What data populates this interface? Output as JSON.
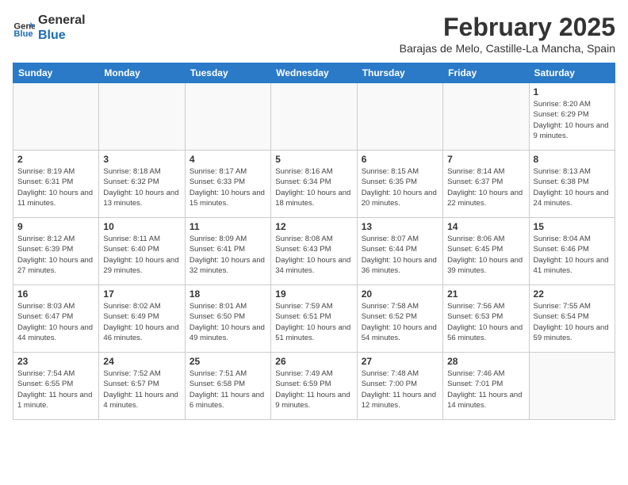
{
  "logo": {
    "line1": "General",
    "line2": "Blue"
  },
  "title": "February 2025",
  "location": "Barajas de Melo, Castille-La Mancha, Spain",
  "days_of_week": [
    "Sunday",
    "Monday",
    "Tuesday",
    "Wednesday",
    "Thursday",
    "Friday",
    "Saturday"
  ],
  "weeks": [
    [
      {
        "day": "",
        "info": ""
      },
      {
        "day": "",
        "info": ""
      },
      {
        "day": "",
        "info": ""
      },
      {
        "day": "",
        "info": ""
      },
      {
        "day": "",
        "info": ""
      },
      {
        "day": "",
        "info": ""
      },
      {
        "day": "1",
        "info": "Sunrise: 8:20 AM\nSunset: 6:29 PM\nDaylight: 10 hours and 9 minutes."
      }
    ],
    [
      {
        "day": "2",
        "info": "Sunrise: 8:19 AM\nSunset: 6:31 PM\nDaylight: 10 hours and 11 minutes."
      },
      {
        "day": "3",
        "info": "Sunrise: 8:18 AM\nSunset: 6:32 PM\nDaylight: 10 hours and 13 minutes."
      },
      {
        "day": "4",
        "info": "Sunrise: 8:17 AM\nSunset: 6:33 PM\nDaylight: 10 hours and 15 minutes."
      },
      {
        "day": "5",
        "info": "Sunrise: 8:16 AM\nSunset: 6:34 PM\nDaylight: 10 hours and 18 minutes."
      },
      {
        "day": "6",
        "info": "Sunrise: 8:15 AM\nSunset: 6:35 PM\nDaylight: 10 hours and 20 minutes."
      },
      {
        "day": "7",
        "info": "Sunrise: 8:14 AM\nSunset: 6:37 PM\nDaylight: 10 hours and 22 minutes."
      },
      {
        "day": "8",
        "info": "Sunrise: 8:13 AM\nSunset: 6:38 PM\nDaylight: 10 hours and 24 minutes."
      }
    ],
    [
      {
        "day": "9",
        "info": "Sunrise: 8:12 AM\nSunset: 6:39 PM\nDaylight: 10 hours and 27 minutes."
      },
      {
        "day": "10",
        "info": "Sunrise: 8:11 AM\nSunset: 6:40 PM\nDaylight: 10 hours and 29 minutes."
      },
      {
        "day": "11",
        "info": "Sunrise: 8:09 AM\nSunset: 6:41 PM\nDaylight: 10 hours and 32 minutes."
      },
      {
        "day": "12",
        "info": "Sunrise: 8:08 AM\nSunset: 6:43 PM\nDaylight: 10 hours and 34 minutes."
      },
      {
        "day": "13",
        "info": "Sunrise: 8:07 AM\nSunset: 6:44 PM\nDaylight: 10 hours and 36 minutes."
      },
      {
        "day": "14",
        "info": "Sunrise: 8:06 AM\nSunset: 6:45 PM\nDaylight: 10 hours and 39 minutes."
      },
      {
        "day": "15",
        "info": "Sunrise: 8:04 AM\nSunset: 6:46 PM\nDaylight: 10 hours and 41 minutes."
      }
    ],
    [
      {
        "day": "16",
        "info": "Sunrise: 8:03 AM\nSunset: 6:47 PM\nDaylight: 10 hours and 44 minutes."
      },
      {
        "day": "17",
        "info": "Sunrise: 8:02 AM\nSunset: 6:49 PM\nDaylight: 10 hours and 46 minutes."
      },
      {
        "day": "18",
        "info": "Sunrise: 8:01 AM\nSunset: 6:50 PM\nDaylight: 10 hours and 49 minutes."
      },
      {
        "day": "19",
        "info": "Sunrise: 7:59 AM\nSunset: 6:51 PM\nDaylight: 10 hours and 51 minutes."
      },
      {
        "day": "20",
        "info": "Sunrise: 7:58 AM\nSunset: 6:52 PM\nDaylight: 10 hours and 54 minutes."
      },
      {
        "day": "21",
        "info": "Sunrise: 7:56 AM\nSunset: 6:53 PM\nDaylight: 10 hours and 56 minutes."
      },
      {
        "day": "22",
        "info": "Sunrise: 7:55 AM\nSunset: 6:54 PM\nDaylight: 10 hours and 59 minutes."
      }
    ],
    [
      {
        "day": "23",
        "info": "Sunrise: 7:54 AM\nSunset: 6:55 PM\nDaylight: 11 hours and 1 minute."
      },
      {
        "day": "24",
        "info": "Sunrise: 7:52 AM\nSunset: 6:57 PM\nDaylight: 11 hours and 4 minutes."
      },
      {
        "day": "25",
        "info": "Sunrise: 7:51 AM\nSunset: 6:58 PM\nDaylight: 11 hours and 6 minutes."
      },
      {
        "day": "26",
        "info": "Sunrise: 7:49 AM\nSunset: 6:59 PM\nDaylight: 11 hours and 9 minutes."
      },
      {
        "day": "27",
        "info": "Sunrise: 7:48 AM\nSunset: 7:00 PM\nDaylight: 11 hours and 12 minutes."
      },
      {
        "day": "28",
        "info": "Sunrise: 7:46 AM\nSunset: 7:01 PM\nDaylight: 11 hours and 14 minutes."
      },
      {
        "day": "",
        "info": ""
      }
    ]
  ]
}
